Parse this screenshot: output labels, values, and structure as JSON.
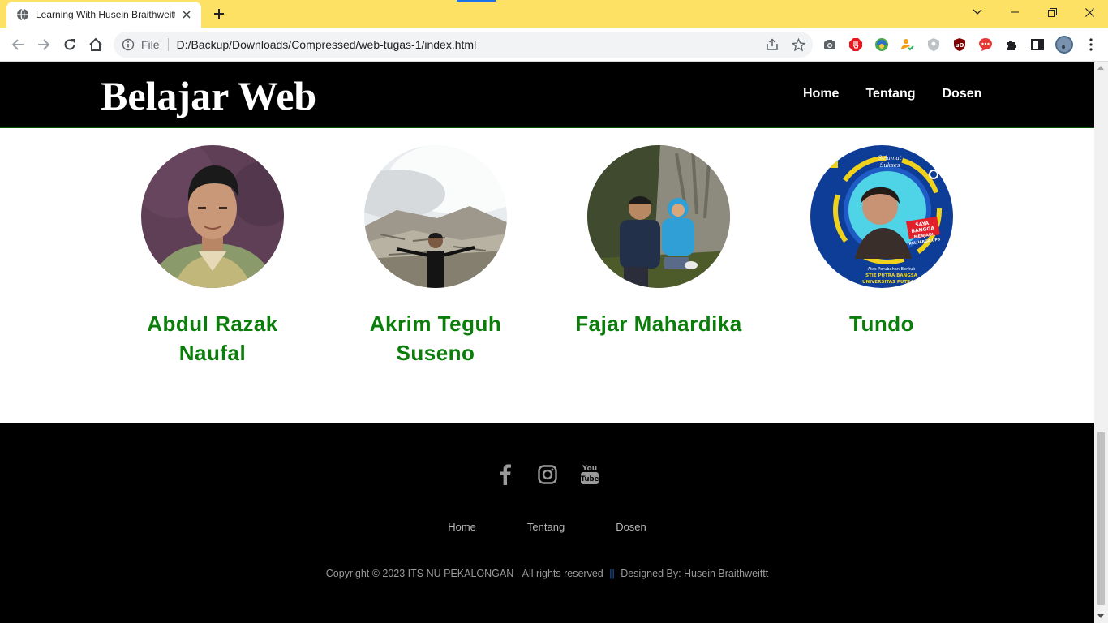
{
  "browser": {
    "tab_title": "Learning With Husein Braithweittt",
    "omnibox_scheme": "File",
    "url": "D:/Backup/Downloads/Compressed/web-tugas-1/index.html"
  },
  "site": {
    "brand": "Belajar Web",
    "nav": [
      "Home",
      "Tentang",
      "Dosen"
    ]
  },
  "lecturers": [
    {
      "name": "Abdul Razak Naufal"
    },
    {
      "name": "Akrim Teguh Suseno"
    },
    {
      "name": "Fajar Mahardika"
    },
    {
      "name": "Tundo"
    }
  ],
  "photo_text": {
    "line1": "SAYA",
    "line2": "BANGGA",
    "line3": "MENJADI",
    "line4": "KELUARGA UPB",
    "greet1": "Selamat",
    "greet2": "Sukses",
    "caption1": "Atas Perubahan Bentuk",
    "caption2": "STIE PUTRA BANGSA",
    "caption3": "UNIVERSITAS PUTRA B..."
  },
  "footer": {
    "social_icons": [
      "facebook-icon",
      "instagram-icon",
      "youtube-icon"
    ],
    "nav": [
      "Home",
      "Tentang",
      "Dosen"
    ],
    "copyright_left": "Copyright © 2023 ITS NU PEKALONGAN - All rights reserved",
    "copyright_sep": "||",
    "copyright_right": "Designed By: Husein Braithweittt"
  },
  "colors": {
    "tabbar": "#fde164",
    "header": "#000000",
    "name_green": "#0b7d0b",
    "footer_text": "#b5b5b5"
  }
}
